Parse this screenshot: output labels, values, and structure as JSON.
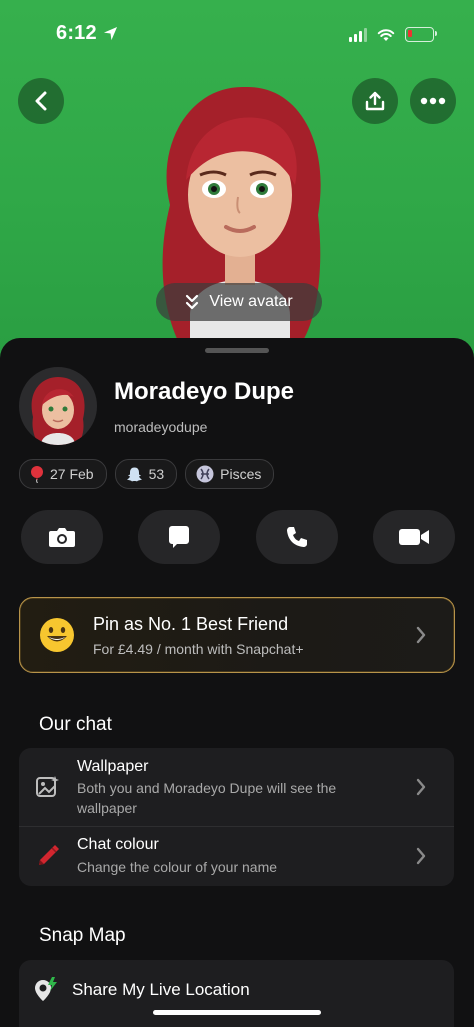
{
  "status_bar": {
    "time": "6:12"
  },
  "hero": {
    "view_avatar_label": "View avatar"
  },
  "profile": {
    "display_name": "Moradeyo Dupe",
    "username": "moradeyodupe",
    "chips": [
      {
        "icon": "balloon-icon",
        "label": "27 Feb"
      },
      {
        "icon": "ghost-icon",
        "label": "53"
      },
      {
        "icon": "pisces-icon",
        "label": "Pisces"
      }
    ]
  },
  "pin_card": {
    "title": "Pin as No. 1 Best Friend",
    "subtitle": "For £4.49 / month with Snapchat+"
  },
  "our_chat": {
    "heading": "Our chat",
    "wallpaper_title": "Wallpaper",
    "wallpaper_subtitle": "Both you and Moradeyo Dupe will see the wallpaper",
    "chat_colour_title": "Chat colour",
    "chat_colour_subtitle": "Change the colour of your name"
  },
  "snap_map": {
    "heading": "Snap Map",
    "share_location": "Share My Live Location"
  },
  "colors": {
    "hero_green": "#36b04d",
    "sheet_bg": "#111112",
    "gold_border": "#b8944a",
    "battery_red": "#e33333"
  }
}
